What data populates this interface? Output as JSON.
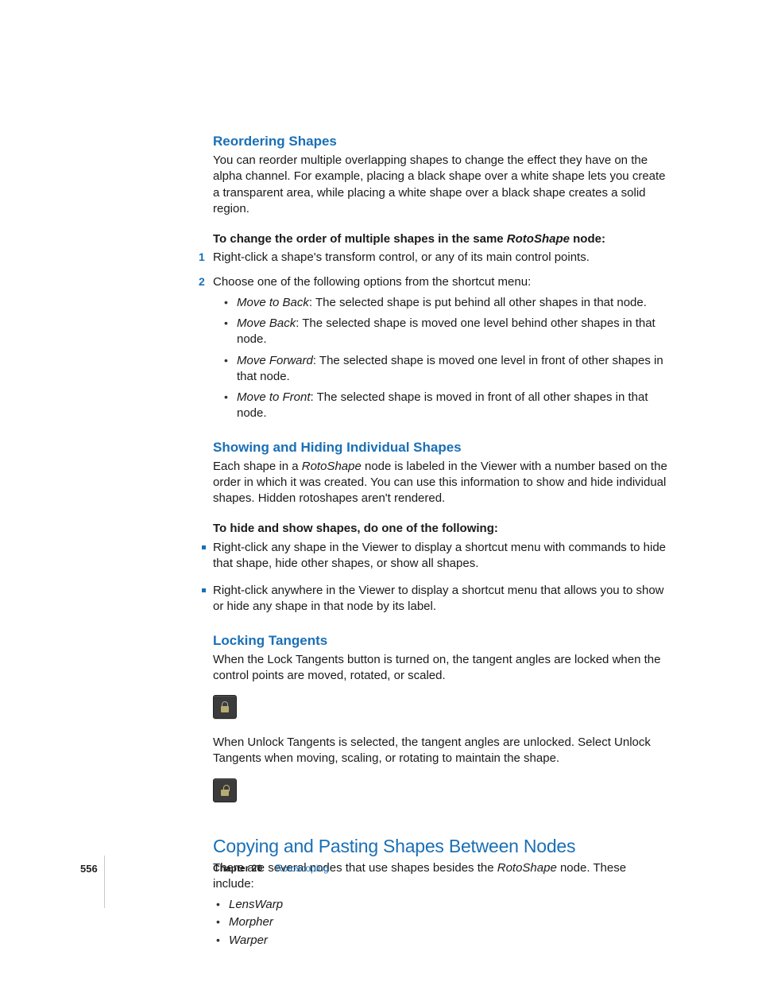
{
  "sec1": {
    "heading": "Reordering Shapes",
    "p1a": "You can reorder multiple overlapping shapes to change the effect they have on the alpha channel. For example, placing a black shape over a white shape lets you create a transparent area, while placing a white shape over a black shape creates a solid region.",
    "lead_a": "To change the order of multiple shapes in the same ",
    "lead_em": "RotoShape",
    "lead_b": " node:",
    "step1": "Right-click a shape's transform control, or any of its main control points.",
    "step2": "Choose one of the following options from the shortcut menu:",
    "opts": [
      {
        "em": "Move to Back",
        "text": ":  The selected shape is put behind all other shapes in that node."
      },
      {
        "em": "Move Back",
        "text": ":  The selected shape is moved one level behind other shapes in that node."
      },
      {
        "em": "Move Forward",
        "text": ":  The selected shape is moved one level in front of other shapes in that node."
      },
      {
        "em": "Move to Front",
        "text": ":  The selected shape is moved in front of all other shapes in that node."
      }
    ]
  },
  "sec2": {
    "heading": "Showing and Hiding Individual Shapes",
    "p1a": "Each shape in a ",
    "p1em": "RotoShape",
    "p1b": " node is labeled in the Viewer with a number based on the order in which it was created. You can use this information to show and hide individual shapes. Hidden rotoshapes aren't rendered.",
    "lead": "To hide and show shapes, do one of the following:",
    "b1": "Right-click any shape in the Viewer to display a shortcut menu with commands to hide that shape, hide other shapes, or show all shapes.",
    "b2": "Right-click anywhere in the Viewer to display a shortcut menu that allows you to show or hide any shape in that node by its label."
  },
  "sec3": {
    "heading": "Locking Tangents",
    "p1": "When the Lock Tangents button is turned on, the tangent angles are locked when the control points are moved, rotated, or scaled.",
    "p2": "When Unlock Tangents is selected, the tangent angles are unlocked. Select Unlock Tangents when moving, scaling, or rotating to maintain the shape."
  },
  "sec4": {
    "heading": "Copying and Pasting Shapes Between Nodes",
    "p1a": "There are several nodes that use shapes besides the ",
    "p1em": "RotoShape",
    "p1b": " node. These include:",
    "items": [
      "LensWarp",
      "Morpher",
      "Warper"
    ]
  },
  "footer": {
    "page": "556",
    "chapter_label": "Chapter 20",
    "chapter_title": "Rotoscoping"
  }
}
